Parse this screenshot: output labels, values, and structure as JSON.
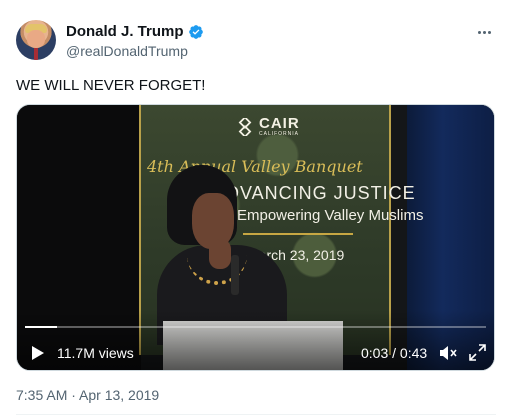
{
  "author": {
    "display_name": "Donald J. Trump",
    "handle": "@realDonaldTrump",
    "verified": true,
    "avatar_icon": "profile-photo"
  },
  "tweet": {
    "text": "WE WILL NEVER FORGET!",
    "timestamp": "7:35 AM · Apr 13, 2019"
  },
  "video": {
    "banner_logo": "CAIR",
    "banner_logo_sub": "CALIFORNIA",
    "banner_title": "4th Annual Valley Banquet",
    "banner_line1": "ADVANCING JUSTICE",
    "banner_line2": "Empowering Valley Muslims",
    "banner_date": "March 23, 2019",
    "views": "11.7M views",
    "time": "0:03 / 0:43",
    "progress_fraction": 0.07
  },
  "icons": {
    "more": "more-options-icon",
    "play": "play-icon",
    "mute": "mute-icon",
    "fullscreen": "fullscreen-icon",
    "verified": "verified-badge-icon"
  },
  "colors": {
    "text_primary": "#0f1419",
    "text_secondary": "#536471",
    "verified_blue": "#1d9bf0"
  }
}
